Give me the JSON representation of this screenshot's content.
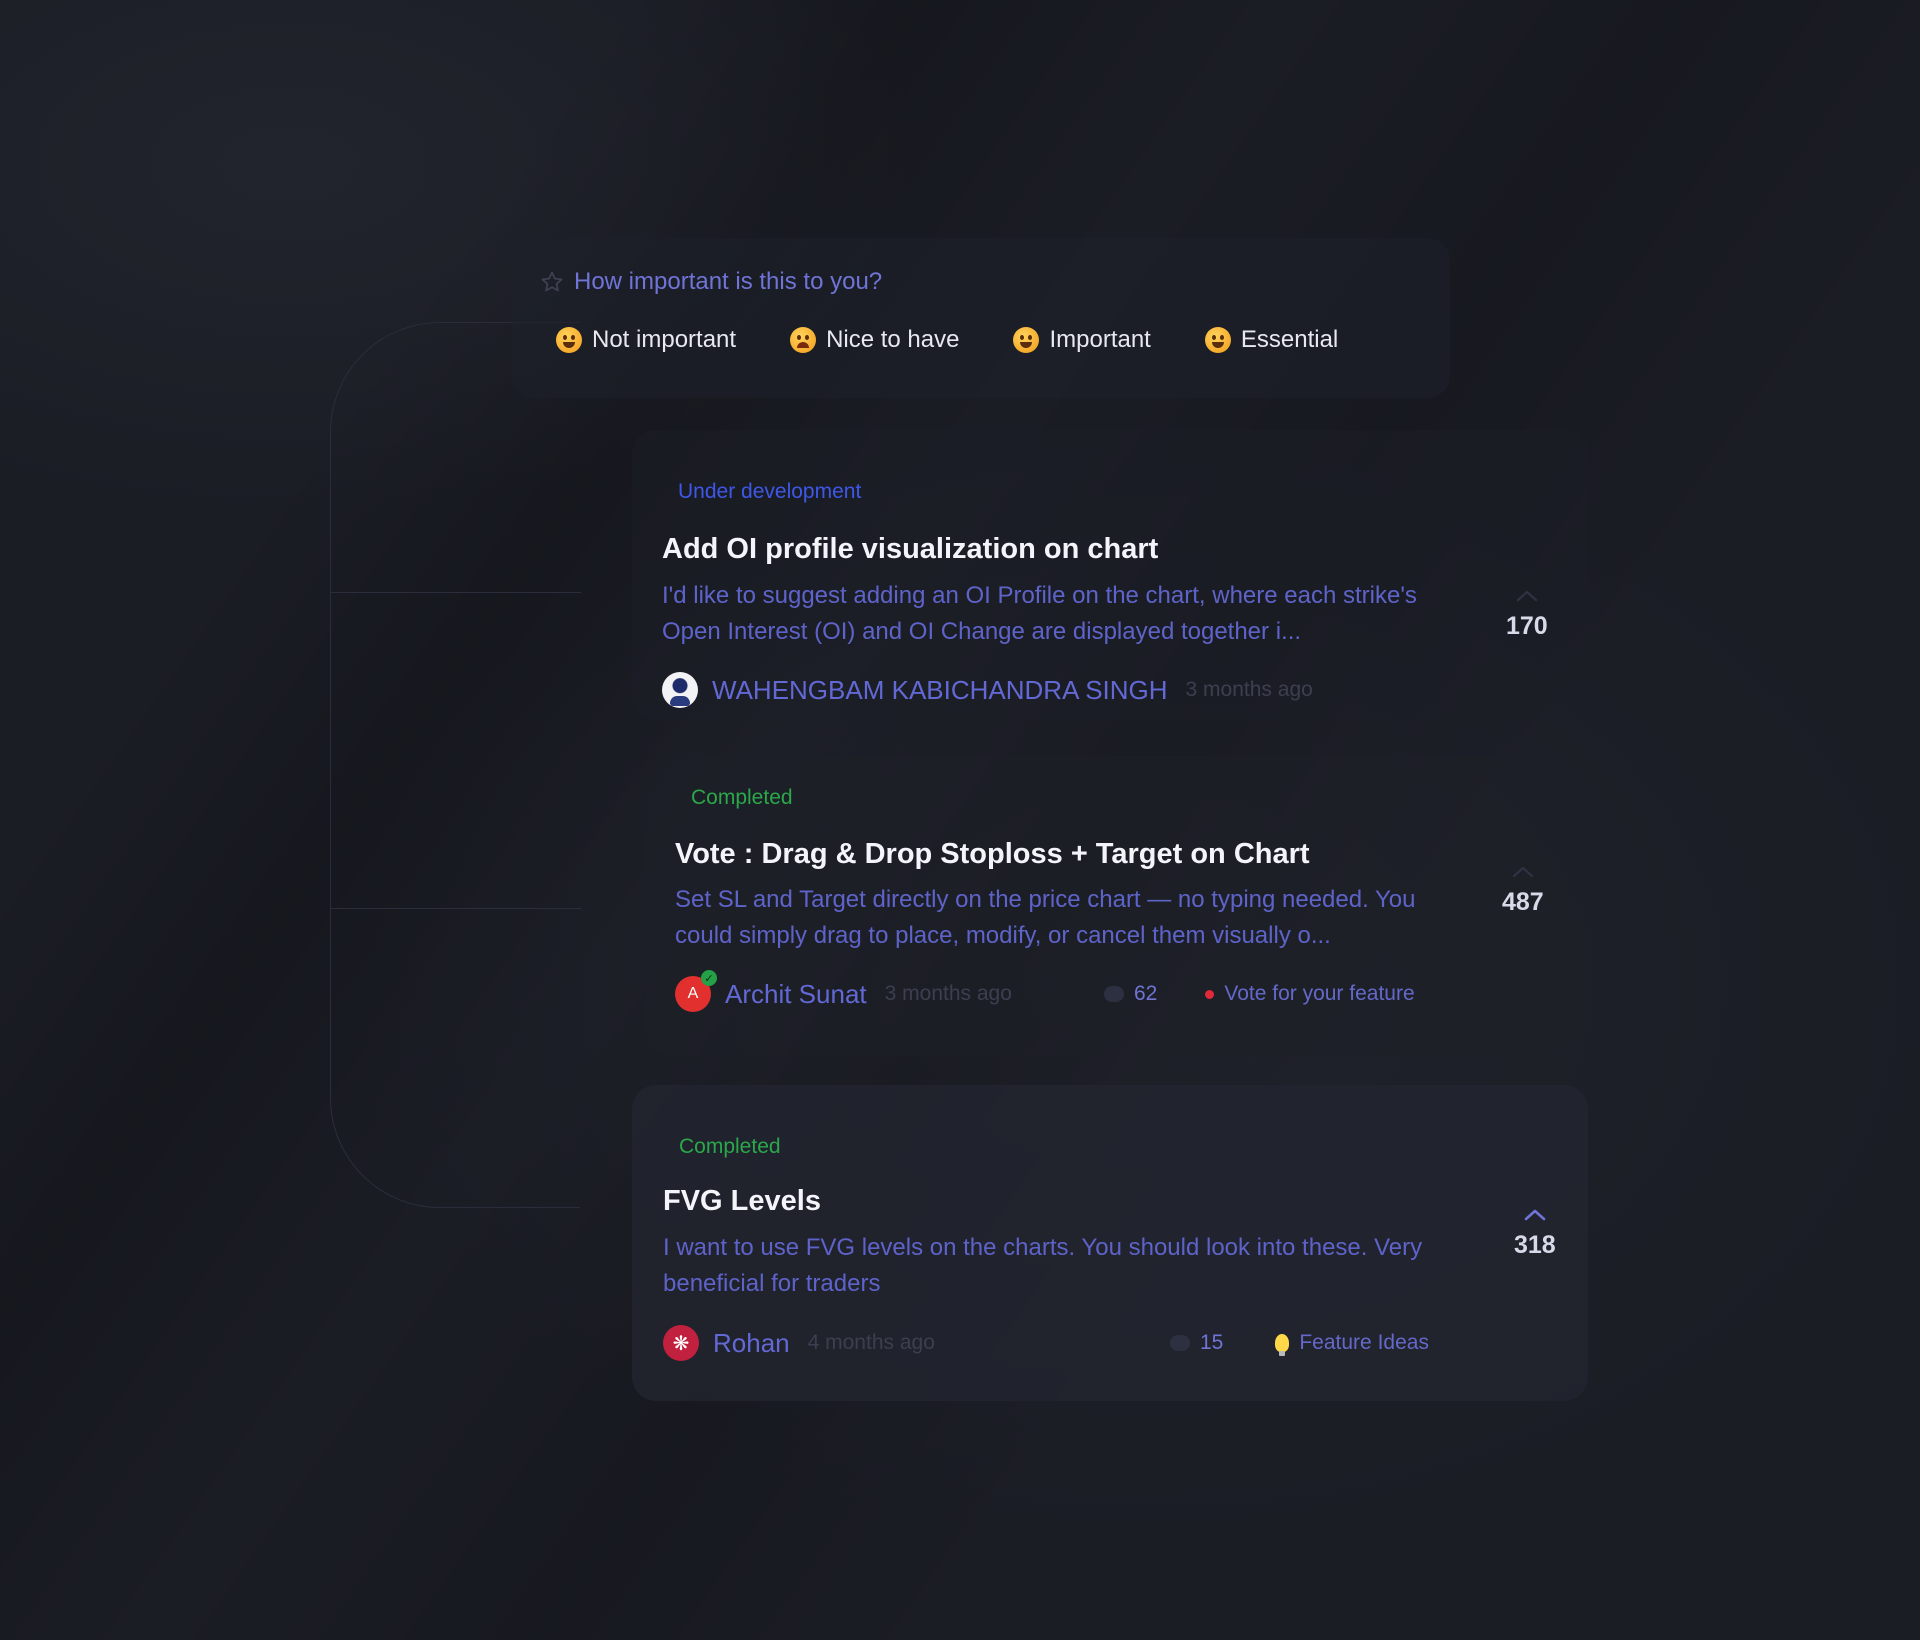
{
  "importance": {
    "title": "How important is this to you?",
    "options": [
      {
        "label": "Not important",
        "icon": "grimace-emoji-icon"
      },
      {
        "label": "Nice to have",
        "icon": "pouting-emoji-icon"
      },
      {
        "label": "Important",
        "icon": "smile-emoji-icon"
      },
      {
        "label": "Essential",
        "icon": "star-struck-emoji-icon"
      }
    ]
  },
  "posts": [
    {
      "status": "Under development",
      "status_color": "#3e57e8",
      "title": "Add OI profile visualization on chart",
      "description": "I'd like to suggest adding an OI Profile on the chart, where each strike's Open Interest (OI) and OI Change are displayed together i...",
      "author": "WAHENGBAM KABICHANDRA SINGH",
      "time_ago": "3 months ago",
      "votes": "170"
    },
    {
      "status": "Completed",
      "status_color": "#2aa84a",
      "title": "Vote : Drag & Drop Stoploss + Target on Chart",
      "description": "Set SL and Target directly on the price chart — no typing needed. You could simply drag to place, modify, or cancel them visually o...",
      "author": "Archit Sunat",
      "avatar_initial": "A",
      "time_ago": "3 months ago",
      "comments": "62",
      "category": "Vote for your feature",
      "votes": "487"
    },
    {
      "status": "Completed",
      "status_color": "#2aa84a",
      "title": "FVG Levels",
      "description": "I want to use FVG levels on the charts. You should look into these. Very beneficial for traders",
      "author": "Rohan",
      "time_ago": "4 months ago",
      "comments": "15",
      "category": "Feature Ideas",
      "votes": "318"
    }
  ]
}
